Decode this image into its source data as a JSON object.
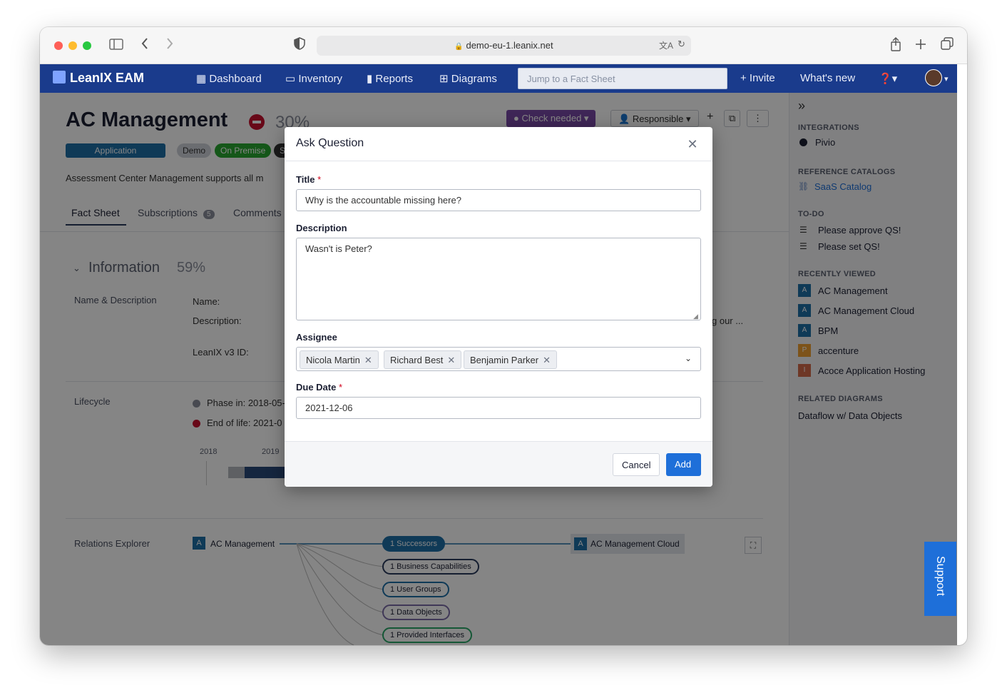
{
  "browser": {
    "url": "demo-eu-1.leanix.net"
  },
  "nav": {
    "logo": "LeanIX EAM",
    "items": [
      "Dashboard",
      "Inventory",
      "Reports",
      "Diagrams"
    ],
    "search_placeholder": "Jump to a Fact Sheet",
    "invite": "+ Invite",
    "whats_new": "What's new"
  },
  "factsheet": {
    "title": "AC Management",
    "completion": "30%",
    "tags": [
      "Application",
      "Demo",
      "On Premise",
      "S"
    ],
    "quality_badge": "Check needed",
    "responsible": "Responsible",
    "description": "Assessment Center Management supports all m",
    "tabs": [
      {
        "label": "Fact Sheet",
        "count": ""
      },
      {
        "label": "Subscriptions",
        "count": "5"
      },
      {
        "label": "Comments",
        "count": ""
      }
    ],
    "information": {
      "title": "Information",
      "completion": "59%",
      "section": "Name & Description",
      "fields": [
        "Name:",
        "Description:",
        "LeanIX v3 ID:"
      ],
      "desc_tail": "g our ..."
    },
    "lifecycle": {
      "section": "Lifecycle",
      "phase_in": "Phase in: 2018-05-",
      "end_of_life": "End of life: 2021-0",
      "years": [
        "2018",
        "2019"
      ]
    },
    "relations": {
      "section": "Relations Explorer",
      "source": "AC Management",
      "target": "AC Management Cloud",
      "pills": [
        {
          "label": "1 Successors",
          "color": "#1e6fa8",
          "filled": true
        },
        {
          "label": "1 Business Capabilities",
          "color": "#2a3b5c",
          "filled": false
        },
        {
          "label": "1 User Groups",
          "color": "#1e6fa8",
          "filled": false
        },
        {
          "label": "1 Data Objects",
          "color": "#7b6ba8",
          "filled": false
        },
        {
          "label": "1 Provided Interfaces",
          "color": "#2aa868",
          "filled": false
        }
      ]
    }
  },
  "sidebar": {
    "integrations": {
      "heading": "INTEGRATIONS",
      "items": [
        "Pivio"
      ]
    },
    "reference_catalogs": {
      "heading": "REFERENCE CATALOGS",
      "items": [
        "SaaS Catalog"
      ]
    },
    "todo": {
      "heading": "TO-DO",
      "items": [
        "Please approve QS!",
        "Please set QS!"
      ]
    },
    "recently_viewed": {
      "heading": "RECENTLY VIEWED",
      "items": [
        {
          "letter": "A",
          "label": "AC Management",
          "color": "#1e6fa8"
        },
        {
          "letter": "A",
          "label": "AC Management Cloud",
          "color": "#1e6fa8"
        },
        {
          "letter": "A",
          "label": "BPM",
          "color": "#1e6fa8"
        },
        {
          "letter": "P",
          "label": "accenture",
          "color": "#f0a030"
        },
        {
          "letter": "I",
          "label": "Acoce Application Hosting",
          "color": "#d46a4a"
        }
      ]
    },
    "related_diagrams": {
      "heading": "RELATED DIAGRAMS",
      "items": [
        "Dataflow w/ Data Objects"
      ]
    }
  },
  "support": "Support",
  "modal": {
    "title": "Ask Question",
    "title_label": "Title",
    "title_value": "Why is the accountable missing here?",
    "description_label": "Description",
    "description_value": "Wasn't is Peter?",
    "assignee_label": "Assignee",
    "assignees": [
      "Nicola Martin",
      "Richard Best",
      "Benjamin Parker"
    ],
    "due_date_label": "Due Date",
    "due_date_value": "2021-12-06",
    "cancel": "Cancel",
    "add": "Add"
  },
  "colors": {
    "nav_bg": "#1a3b8c",
    "primary": "#1e6fd9",
    "check_needed": "#7a4aa8",
    "on_premise": "#2aa830"
  }
}
